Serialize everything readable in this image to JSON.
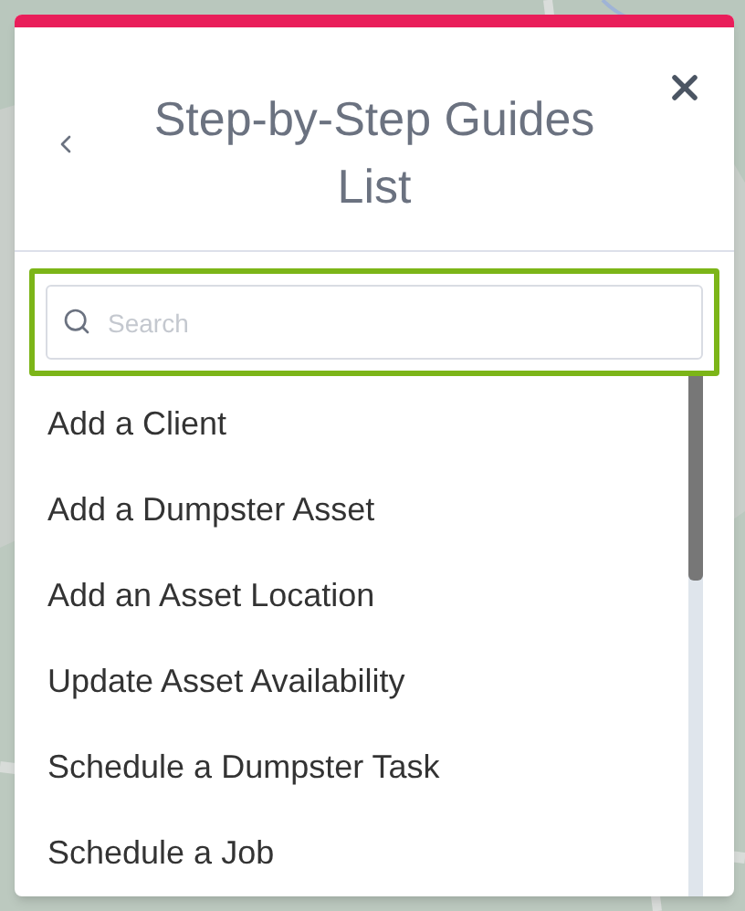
{
  "panel": {
    "title": "Step-by-Step Guides List"
  },
  "search": {
    "placeholder": "Search",
    "highlighted": true
  },
  "guides": [
    {
      "label": "Add a Client"
    },
    {
      "label": "Add a Dumpster Asset"
    },
    {
      "label": "Add an Asset Location"
    },
    {
      "label": "Update Asset Availability"
    },
    {
      "label": "Schedule a Dumpster Task"
    },
    {
      "label": "Schedule a Job"
    }
  ]
}
